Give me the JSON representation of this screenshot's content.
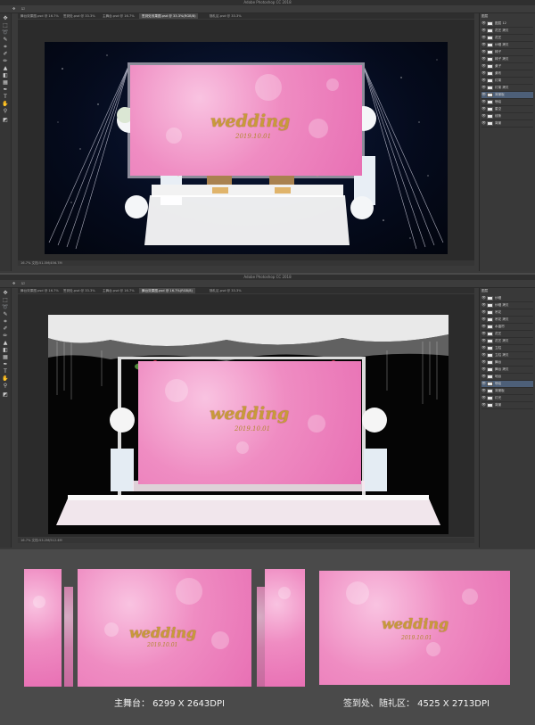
{
  "app": {
    "title": "Adobe Photoshop CC 2018"
  },
  "window1": {
    "tabs": [
      "舞台效果图.psd @ 16.7%",
      "签到处.psd @ 33.3%",
      "主舞台.psd @ 16.7%",
      "签到处效果图.psd @ 33.3%(RGB/8)",
      "随礼区.psd @ 33.3%"
    ],
    "status": "16.7%   文档:51.5M/456.7M",
    "panel_title": "图层",
    "layers": [
      "图层 12",
      "花艺 拷贝",
      "花艺",
      "纱幔 拷贝",
      "椅子",
      "椅子 拷贝",
      "桌子",
      "桌布",
      "灯架",
      "灯架 拷贝",
      "背景板",
      "喷绘",
      "星空",
      "线条",
      "背景"
    ]
  },
  "window2": {
    "tabs": [
      "舞台效果图.psd @ 16.7%",
      "签到处.psd @ 33.3%",
      "主舞台.psd @ 16.7%",
      "舞台效果图.psd @ 16.7%(RGB/8)",
      "随礼区.psd @ 33.3%"
    ],
    "status": "16.7%   文档:53.2M/512.4M",
    "panel_title": "图层",
    "layers": [
      "纱幔",
      "纱幔 拷贝",
      "吊花",
      "吊花 拷贝",
      "水晶帘",
      "花艺",
      "花艺 拷贝",
      "立柱",
      "立柱 拷贝",
      "舞台",
      "舞台 拷贝",
      "地台",
      "喷绘",
      "背景板",
      "灯光",
      "背景"
    ]
  },
  "design": {
    "wedding_text": "wedding",
    "date_text": "2019.10.01"
  },
  "labels": {
    "main_stage": "主舞台： 6299 X 2643DPI",
    "signin_gift": "签到处、随礼区： 4525 X 2713DPI"
  },
  "colors": {
    "pink": "#ef8cc2",
    "gold": "#c99a3a",
    "ui_dark": "#3a3a3a"
  }
}
